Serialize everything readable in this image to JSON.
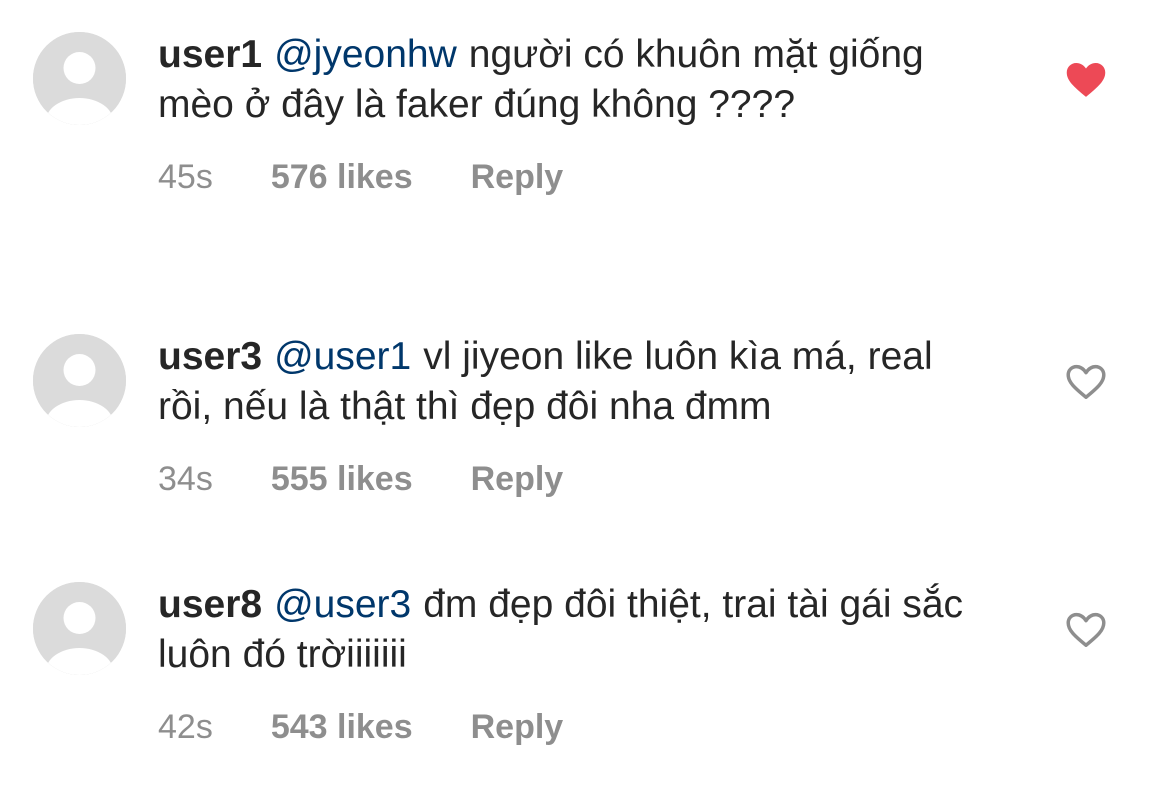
{
  "colors": {
    "text": "#262626",
    "mention": "#00376b",
    "meta": "#8e8e8e",
    "liked_heart": "#ed4956",
    "avatar_bg": "#dbdbdb"
  },
  "comments": [
    {
      "username": "user1",
      "mention": "@jyeonhw",
      "text": "người có khuôn mặt giống mèo ở đây là faker đúng không ????",
      "time": "45s",
      "likes": "576 likes",
      "reply": "Reply",
      "liked": true,
      "like_icon": "heart-filled-icon",
      "avatar_icon": "default-avatar-icon"
    },
    {
      "username": "user3",
      "mention": "@user1",
      "text": "vl jiyeon like luôn kìa má, real rồi, nếu là thật thì đẹp đôi nha đmm",
      "time": "34s",
      "likes": "555 likes",
      "reply": "Reply",
      "liked": false,
      "like_icon": "heart-outline-icon",
      "avatar_icon": "default-avatar-icon"
    },
    {
      "username": "user8",
      "mention": "@user3",
      "text": "đm đẹp đôi thiệt, trai tài gái sắc luôn đó trờiiiiiii",
      "time": "42s",
      "likes": "543 likes",
      "reply": "Reply",
      "liked": false,
      "like_icon": "heart-outline-icon",
      "avatar_icon": "default-avatar-icon"
    }
  ]
}
